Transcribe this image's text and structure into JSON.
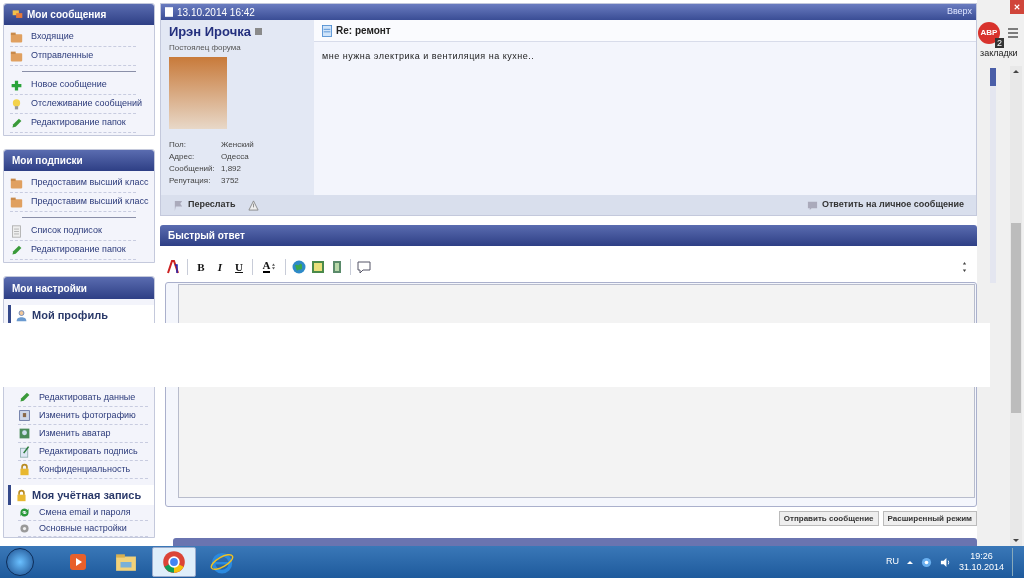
{
  "sidebar": {
    "sections": [
      {
        "kind": "menu",
        "title": "Мои сообщения",
        "groups": [
          [
            "Входящие",
            "Отправленные"
          ],
          [
            "Новое сообщение",
            "Отслеживание сообщений",
            "Редактирование папок"
          ]
        ]
      },
      {
        "kind": "menu",
        "title": "Мои подписки",
        "groups": [
          [
            "Предоставим высший класс",
            "Предоставим высший класс"
          ],
          [
            "Список подписок",
            "Редактирование папок"
          ]
        ]
      },
      {
        "kind": "settings",
        "title": "Мои настройки",
        "blocks": [
          {
            "title": "Мой профиль",
            "items": [
              "Редактировать данные",
              "Изменить фотографию",
              "Изменить аватар",
              "Редактировать подпись",
              "Конфиденциальность"
            ]
          },
          {
            "title": "Моя учётная запись",
            "items": [
              "Смена email и пароля",
              "Основные настройки"
            ]
          }
        ]
      }
    ]
  },
  "post": {
    "date": "13.10.2014 16:42",
    "top_link": "Вверх",
    "author": {
      "name": "Ирэн Ирочка",
      "online": false,
      "rank": "Постоялец форума",
      "stats": [
        {
          "label": "Пол:",
          "value": "Женский"
        },
        {
          "label": "Адрес:",
          "value": "Одесса"
        },
        {
          "label": "Сообщений:",
          "value": "1,892"
        },
        {
          "label": "Репутация:",
          "value": "3752"
        }
      ]
    },
    "title": "Re: ремонт",
    "body": "мне нужна электрика и вентиляция на кухне..",
    "forward": "Переслать",
    "reply": "Ответить на личное сообщение"
  },
  "quick_reply": {
    "title": "Быстрый ответ",
    "toolbar": [
      {
        "kind": "font"
      },
      {
        "kind": "sep"
      },
      {
        "kind": "bold",
        "label": "B"
      },
      {
        "kind": "italic",
        "label": "I"
      },
      {
        "kind": "underline",
        "label": "U"
      },
      {
        "kind": "sep"
      },
      {
        "kind": "color",
        "label": "A"
      },
      {
        "kind": "sep"
      },
      {
        "kind": "link"
      },
      {
        "kind": "image"
      },
      {
        "kind": "video"
      },
      {
        "kind": "sep"
      },
      {
        "kind": "quote"
      }
    ],
    "buttons": [
      "Отправить сообщение",
      "Расширенный режим"
    ]
  },
  "browser": {
    "abp_label": "ABP",
    "abp_count": "2",
    "bookmarks": "закладки"
  },
  "taskbar": {
    "apps": [
      {
        "selected": false
      },
      {
        "selected": false
      },
      {
        "selected": true
      },
      {
        "selected": false
      }
    ],
    "language": "RU",
    "time": "19:26",
    "date": "31.10.2014"
  }
}
